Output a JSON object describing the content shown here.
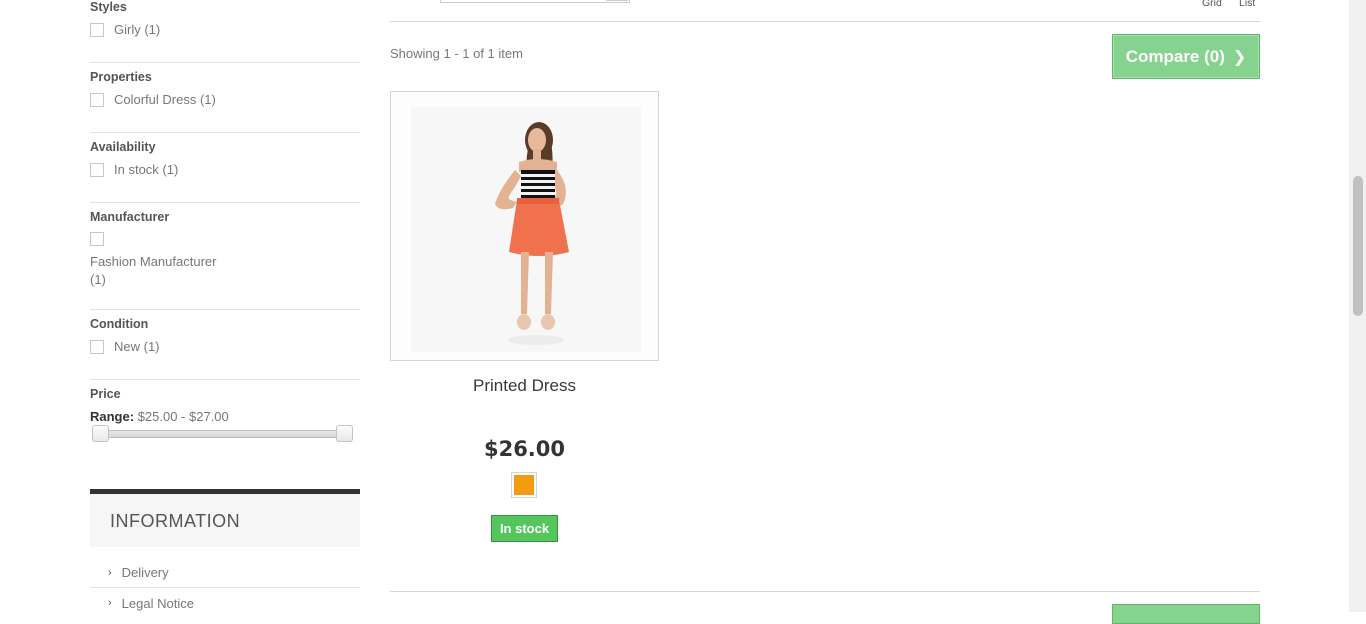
{
  "filters": {
    "styles": {
      "title": "Styles",
      "option": "Girly (1)"
    },
    "properties": {
      "title": "Properties",
      "option": "Colorful Dress (1)"
    },
    "availability": {
      "title": "Availability",
      "option": "In stock (1)"
    },
    "manufacturer": {
      "title": "Manufacturer",
      "option_line1": "Fashion Manufacturer",
      "option_line2": "(1)"
    },
    "condition": {
      "title": "Condition",
      "option": "New (1)"
    },
    "price": {
      "title": "Price",
      "range_label": "Range:",
      "range_value": "$25.00 - $27.00"
    }
  },
  "information": {
    "title": "INFORMATION",
    "items": [
      {
        "label": "Delivery"
      },
      {
        "label": "Legal Notice"
      }
    ]
  },
  "toolbar": {
    "view_grid": "Grid",
    "view_list": "List",
    "showing": "Showing 1 - 1 of 1 item",
    "compare_label": "Compare (0)"
  },
  "product": {
    "name": "Printed Dress",
    "price": "$26.00",
    "color_swatch": "#f39c11",
    "stock": "In stock",
    "stock_color": "#55c65e"
  },
  "colors": {
    "compare_bg": "#86d28f",
    "info_border": "#333333"
  }
}
